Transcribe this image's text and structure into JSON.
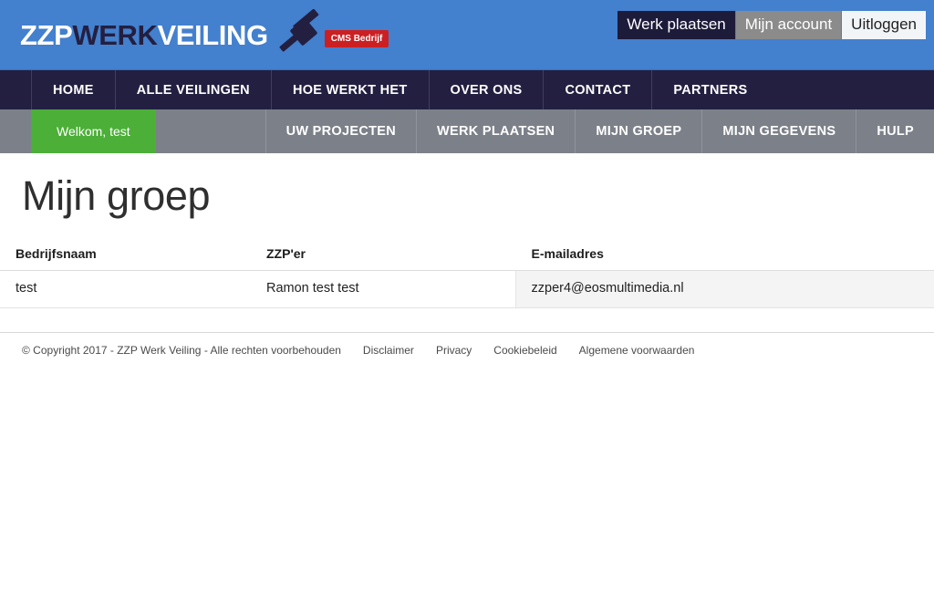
{
  "brand": {
    "logo_part1": "ZZP",
    "logo_part2": "WERK",
    "logo_part3": "VEILING",
    "badge": "CMS Bedrijf",
    "gavel_icon": "gavel-icon"
  },
  "colors": {
    "header_blue": "#4380ce",
    "nav_dark": "#231f41",
    "nav_gray": "#7c8089",
    "welcome_green": "#4caf38",
    "badge_red": "#cc1f22",
    "btn_dark": "#1d1b3a",
    "btn_gray": "#8b8b8b",
    "btn_light": "#f2f5f8"
  },
  "header": {
    "actions": [
      {
        "label": "Werk plaatsen",
        "style": "dark"
      },
      {
        "label": "Mijn account",
        "style": "gray"
      },
      {
        "label": "Uitloggen",
        "style": "light"
      }
    ]
  },
  "nav_main": {
    "items": [
      {
        "label": "HOME"
      },
      {
        "label": "ALLE VEILINGEN"
      },
      {
        "label": "HOE WERKT HET"
      },
      {
        "label": "OVER ONS"
      },
      {
        "label": "CONTACT"
      },
      {
        "label": "PARTNERS"
      }
    ]
  },
  "nav_sub": {
    "welcome": "Welkom, test",
    "items": [
      {
        "label": "UW PROJECTEN"
      },
      {
        "label": "WERK PLAATSEN"
      },
      {
        "label": "MIJN GROEP"
      },
      {
        "label": "MIJN GEGEVENS"
      },
      {
        "label": "HULP"
      }
    ]
  },
  "main": {
    "page_title": "Mijn groep",
    "table": {
      "columns": [
        "Bedrijfsnaam",
        "ZZP'er",
        "E-mailadres"
      ],
      "rows": [
        {
          "bedrijfsnaam": "test",
          "zzper": "Ramon test test",
          "email": "zzper4@eosmultimedia.nl"
        }
      ]
    }
  },
  "footer": {
    "copyright": "© Copyright 2017 - ZZP Werk Veiling - Alle rechten voorbehouden",
    "links": [
      {
        "label": "Disclaimer"
      },
      {
        "label": "Privacy"
      },
      {
        "label": "Cookiebeleid"
      },
      {
        "label": "Algemene voorwaarden"
      }
    ]
  }
}
